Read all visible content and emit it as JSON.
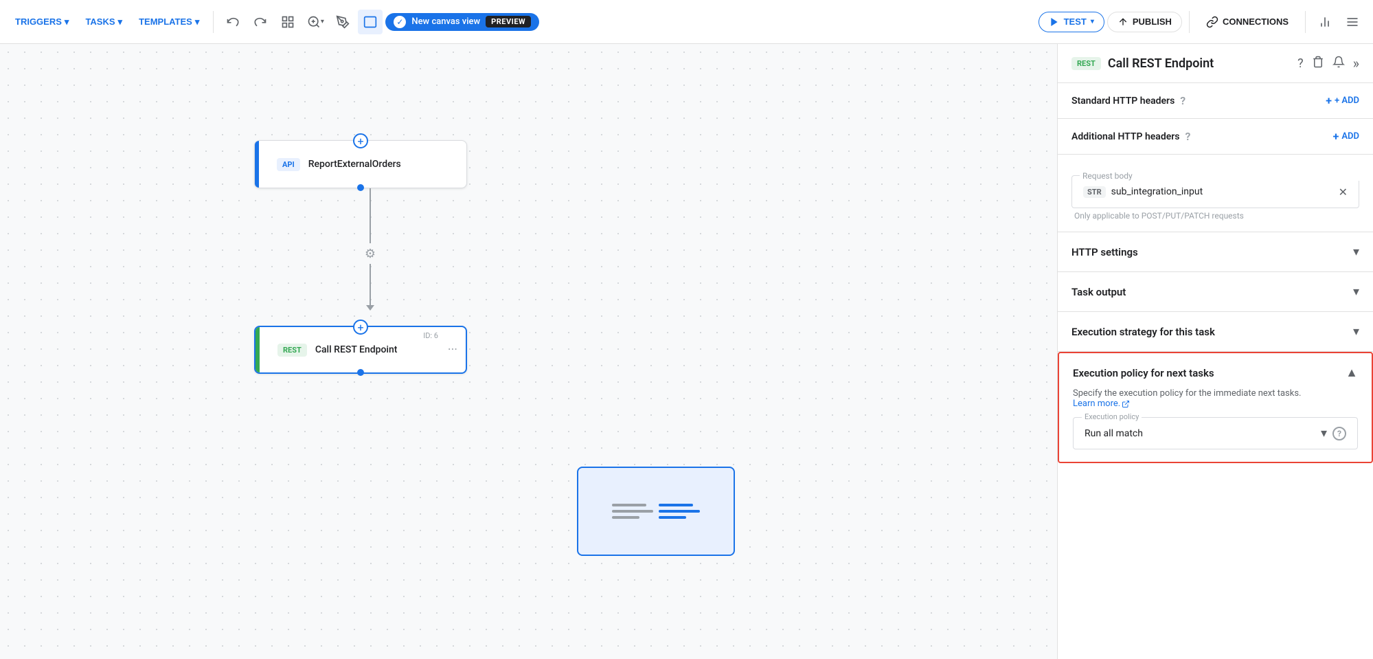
{
  "nav": {
    "triggers_label": "TRIGGERS",
    "tasks_label": "TASKS",
    "templates_label": "TEMPLATES",
    "canvas_toggle_label": "New canvas view",
    "preview_badge": "PREVIEW",
    "test_label": "TEST",
    "publish_label": "PUBLISH",
    "connections_label": "CONNECTIONS"
  },
  "canvas": {
    "node_api_label": "ReportExternalOrders",
    "node_api_badge": "API",
    "node_rest_label": "Call REST Endpoint",
    "node_rest_badge": "REST",
    "node_rest_id": "ID: 6"
  },
  "panel": {
    "rest_badge": "REST",
    "title": "Call REST Endpoint",
    "standard_http_headers_label": "Standard HTTP headers",
    "additional_http_headers_label": "Additional HTTP headers",
    "add_label": "+ ADD",
    "request_body_label": "Request body",
    "str_badge": "STR",
    "request_body_value": "sub_integration_input",
    "request_body_hint": "Only applicable to POST/PUT/PATCH requests",
    "http_settings_label": "HTTP settings",
    "task_output_label": "Task output",
    "execution_strategy_label": "Execution strategy for this task",
    "execution_policy_title": "Execution policy for next tasks",
    "execution_policy_desc": "Specify the execution policy for the immediate next tasks.",
    "learn_more_label": "Learn more.",
    "execution_policy_field_label": "Execution policy",
    "execution_policy_value": "Run all match"
  }
}
